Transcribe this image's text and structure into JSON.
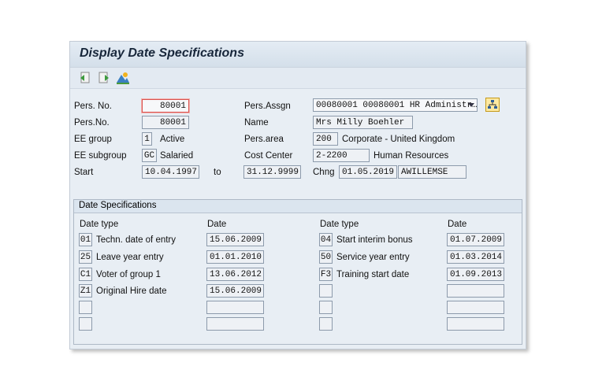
{
  "title": "Display Date Specifications",
  "toolbar": {
    "icons": [
      "previous-record-icon",
      "next-record-icon",
      "overview-icon"
    ]
  },
  "header": {
    "pers_no_label": "Pers. No.",
    "pers_no_value": "80001",
    "pers_no2_label": "Pers.No.",
    "pers_no2_value": "80001",
    "ee_group_label": "EE group",
    "ee_group_code": "1",
    "ee_group_text": "Active",
    "ee_subgroup_label": "EE subgroup",
    "ee_subgroup_code": "GC",
    "ee_subgroup_text": "Salaried",
    "start_label": "Start",
    "start_value": "10.04.1997",
    "to_label": "to",
    "end_value": "31.12.9999",
    "pers_assgn_label": "Pers.Assgn",
    "pers_assgn_value": "00080001 00080001 HR Administr…",
    "name_label": "Name",
    "name_value": "Mrs Milly Boehler",
    "pers_area_label": "Pers.area",
    "pers_area_code": "200",
    "pers_area_text": "Corporate - United Kingdom",
    "cost_center_label": "Cost Center",
    "cost_center_code": "2-2200",
    "cost_center_text": "Human Resources",
    "chng_label": "Chng",
    "chng_date": "01.05.2019",
    "chng_user": "AWILLEMSE"
  },
  "date_specs": {
    "group_title": "Date Specifications",
    "col_date_type": "Date type",
    "col_date": "Date",
    "left": [
      {
        "code": "01",
        "text": "Techn. date of entry",
        "date": "15.06.2009"
      },
      {
        "code": "25",
        "text": "Leave year entry",
        "date": "01.01.2010"
      },
      {
        "code": "C1",
        "text": "Voter of group 1",
        "date": "13.06.2012"
      },
      {
        "code": "Z1",
        "text": "Original Hire date",
        "date": "15.06.2009"
      },
      {
        "code": "",
        "text": "",
        "date": ""
      },
      {
        "code": "",
        "text": "",
        "date": ""
      }
    ],
    "right": [
      {
        "code": "04",
        "text": "Start interim bonus",
        "date": "01.07.2009"
      },
      {
        "code": "50",
        "text": "Service year entry",
        "date": "01.03.2014"
      },
      {
        "code": "F3",
        "text": "Training start date",
        "date": "01.09.2013"
      },
      {
        "code": "",
        "text": "",
        "date": ""
      },
      {
        "code": "",
        "text": "",
        "date": ""
      },
      {
        "code": "",
        "text": "",
        "date": ""
      }
    ]
  }
}
